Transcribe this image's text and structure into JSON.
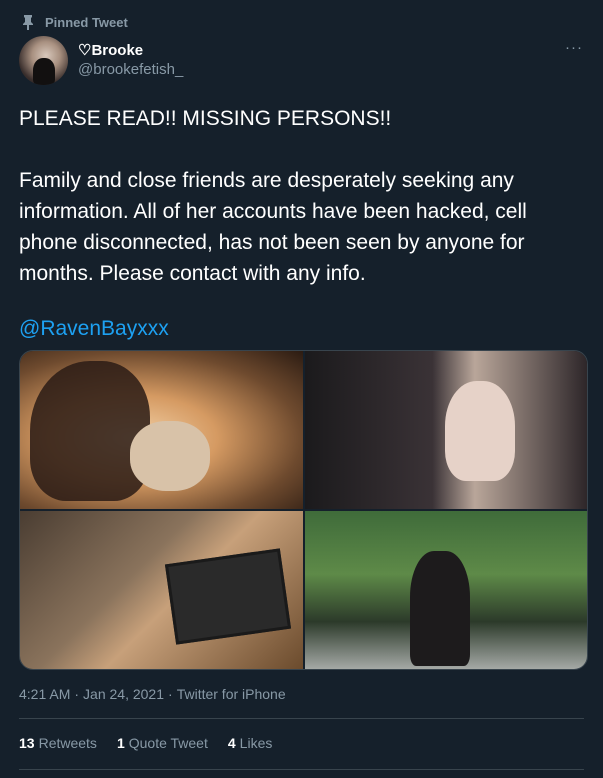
{
  "pinned": {
    "label": "Pinned Tweet",
    "icon": "pin-icon"
  },
  "author": {
    "display_name": "♡Brooke",
    "handle": "@brookefetish_",
    "avatar": "avatar"
  },
  "more_menu": "···",
  "tweet": {
    "line1": "PLEASE READ!! MISSING PERSONS!!",
    "paragraph": "Family and close friends are desperately seeking any information.  All of her accounts have been hacked, cell phone disconnected, has not been seen by anyone for months. Please contact with any info.",
    "mention": "@RavenBayxxx"
  },
  "media": {
    "count": 4
  },
  "meta": {
    "time": "4:21 AM",
    "separator": "·",
    "date": "Jan 24, 2021",
    "separator2": "·",
    "source": "Twitter for iPhone"
  },
  "stats": {
    "retweets_count": "13",
    "retweets_label": "Retweets",
    "quotes_count": "1",
    "quotes_label": "Quote Tweet",
    "likes_count": "4",
    "likes_label": "Likes"
  },
  "colors": {
    "background": "#15202b",
    "accent": "#1da1f2",
    "muted": "#8899a6",
    "border": "#38444d"
  }
}
